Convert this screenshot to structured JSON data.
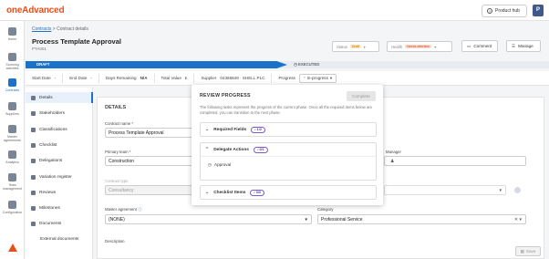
{
  "app": {
    "logo": "oneAdvanced",
    "product_hub": "Product hub",
    "avatar_initial": "P"
  },
  "nav": [
    {
      "label": "Home",
      "icon": "home-icon"
    },
    {
      "label": "Sourcing activities",
      "icon": "sourcing-icon"
    },
    {
      "label": "Contracts",
      "icon": "contracts-icon",
      "active": true
    },
    {
      "label": "Suppliers",
      "icon": "suppliers-icon"
    },
    {
      "label": "Master agreements",
      "icon": "master-agreements-icon"
    },
    {
      "label": "Analytics",
      "icon": "analytics-icon"
    },
    {
      "label": "Team management",
      "icon": "team-icon"
    },
    {
      "label": "Configuration",
      "icon": "configuration-icon"
    }
  ],
  "breadcrumb": {
    "link": "Contracts",
    "sep": ">",
    "current": "Contract details"
  },
  "page": {
    "title": "Process Template Approval",
    "id": "PTA001"
  },
  "status": {
    "label": "Status",
    "value": "Draft"
  },
  "health": {
    "label": "Health",
    "value": "Needs attention"
  },
  "buttons": {
    "comment": "Comment",
    "manage": "Manage",
    "save": "Save"
  },
  "phases": {
    "draft": "DRAFT",
    "executed": "EXECUTED"
  },
  "info": {
    "start_date": "Start Date",
    "start_value": "-",
    "end_date": "End Date",
    "end_value": "-",
    "days_remaining": "Days Remaining",
    "days_value": "N/A",
    "total_value": "Total Value",
    "total_value_val": "£",
    "supplier": "Supplier",
    "supplier_value": "04366849 · SHELL PLC",
    "progress": "Progress",
    "progress_value": "In-progress"
  },
  "subnav": [
    "Details",
    "Stakeholders",
    "Classifications",
    "Checklist",
    "Delegations",
    "Variation register",
    "Reviews",
    "Milestones",
    "Documents",
    "External documents"
  ],
  "details": {
    "section": "DETAILS",
    "contract_name_label": "Contract name *",
    "contract_name": "Process Template Approval",
    "primary_team_label": "Primary team *",
    "primary_team": "Construction",
    "contract_type_label": "Contract type",
    "contract_type": "Consultancy",
    "master_agreement_label": "Master agreement",
    "master_agreement": "(NONE)",
    "category_label": "Category",
    "category": "Professional Service",
    "manager_label": "Manager",
    "description_label": "Description"
  },
  "review": {
    "title": "REVIEW PROGRESS",
    "complete": "Complete",
    "description": "The following tasks represent the progress of the current phase. Once all the required items below are completed, you can transition to the next phase.",
    "sections": [
      {
        "label": "Required Fields",
        "badge": "1/2",
        "expanded": false
      },
      {
        "label": "Delegate Actions",
        "badge": "0/1",
        "expanded": true,
        "items": [
          "Approval"
        ]
      },
      {
        "label": "Checklist Items",
        "badge": "0/0",
        "expanded": false
      }
    ]
  }
}
